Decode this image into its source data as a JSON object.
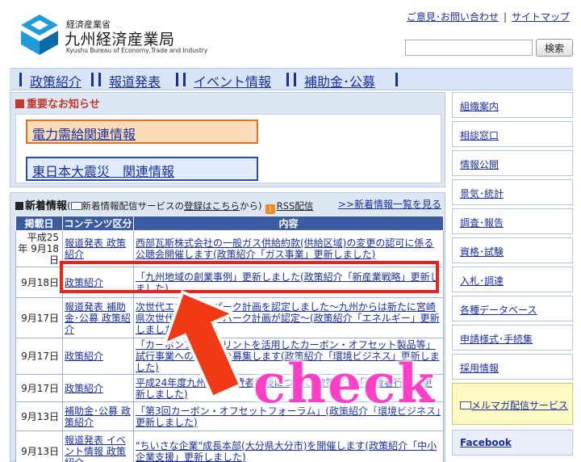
{
  "header": {
    "ministry": "経済産業省",
    "title": "九州経済産業局",
    "title_en": "Kyushu Bureau of Economy,Trade and Industry",
    "contact_link": "ご意見･お問い合わせ",
    "sitemap_link": "サイトマップ",
    "search_button": "検索",
    "search_value": ""
  },
  "nav": {
    "items": [
      {
        "label": "政策紹介"
      },
      {
        "label": "報道発表"
      },
      {
        "label": "イベント情報"
      },
      {
        "label": "補助金･公募"
      }
    ]
  },
  "important": {
    "heading": "重要なお知らせ",
    "power": "電力需給関連情報",
    "quake": "東日本大震災　関連情報"
  },
  "news": {
    "heading": "新着情報",
    "paren_open": "(",
    "mail_text": "新着情報配信サービスの",
    "register_link": "登録はこちら",
    "paren_close": "から)",
    "rss": "RSS配信",
    "more": ">>新着情報一覧を見る",
    "columns": {
      "date": "掲載日",
      "category": "コンテンツ区分",
      "content": "内容"
    },
    "rows": [
      {
        "date": "平成25年 9月18日",
        "category": "報道発表 政策紹介",
        "content": "西部瓦斯株式会社の一般ガス供給約款(供給区域)の変更の認可に係る公聴会開催します(政策紹介「ガス事業」更新しました)"
      },
      {
        "date": "9月18日",
        "category": "政策紹介",
        "content": "「九州地域の創業事例」更新しました(政策紹介「新産業戦略」更新しました)"
      },
      {
        "date": "9月17日",
        "category": "報道発表 補助金･公募 政策紹介",
        "content": "次世代エネルギーパーク計画を認定しました～九州からは新たに宮崎県次世代エネルギーパーク計画が認定～(政策紹介「エネルギー」更新しました)"
      },
      {
        "date": "9月17日",
        "category": "政策紹介",
        "content": "「カーボンフットプリントを活用したカーボン・オフセット製品等」試行事業への参加者を募集します(政策紹介「環境ビジネス」更新しました)"
      },
      {
        "date": "9月17日",
        "category": "政策紹介",
        "content": "平成24年度九州地区消費者相談について(政策紹介「消費者行政」更新しました)"
      },
      {
        "date": "9月13日",
        "category": "補助金･公募 政策紹介",
        "content": "「第3回カーボン・オフセットフォーラム」(政策紹介「環境ビジネス」更新しました)"
      },
      {
        "date": "9月13日",
        "category": "報道発表 イベント情報 政策紹介",
        "content": "\"ちいさな企業\"成長本部(大分県大分市)を開催します(政策紹介「中小企業支援」更新しました)"
      }
    ]
  },
  "sidebar": {
    "items": [
      {
        "label": "組織案内"
      },
      {
        "label": "相談窓口"
      },
      {
        "label": "情報公開"
      },
      {
        "label": "景気･統計"
      },
      {
        "label": "調査･報告"
      },
      {
        "label": "資格･試験"
      },
      {
        "label": "入札･調達"
      },
      {
        "label": "各種データベース"
      },
      {
        "label": "申請様式･手続集"
      },
      {
        "label": "採用情報"
      },
      {
        "label": "メルマガ配信サービス"
      },
      {
        "label": "Facebook"
      }
    ]
  },
  "annotation": {
    "check_text": "check",
    "highlight_color": "#e8231c",
    "arrow_color": "#f03a16",
    "text_color": "#ff3fc8"
  }
}
